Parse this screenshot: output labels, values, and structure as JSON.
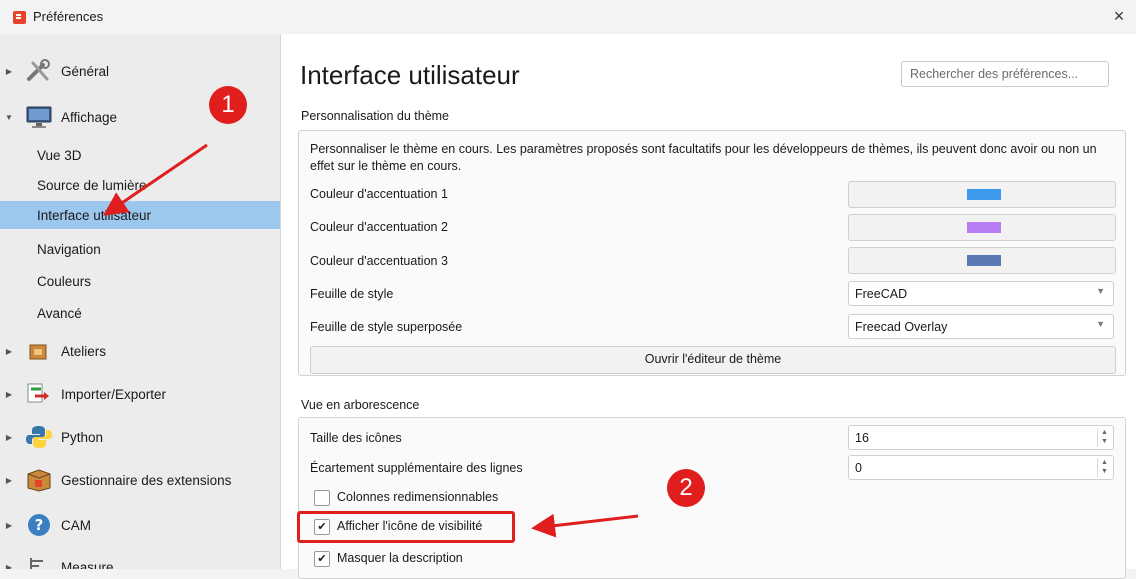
{
  "window": {
    "title": "Préférences",
    "close": "×"
  },
  "sidebar": {
    "items": [
      {
        "label": "Général"
      },
      {
        "label": "Affichage"
      },
      {
        "label": "Ateliers"
      },
      {
        "label": "Importer/Exporter"
      },
      {
        "label": "Python"
      },
      {
        "label": "Gestionnaire des extensions"
      },
      {
        "label": "CAM"
      },
      {
        "label": "Measure"
      }
    ],
    "subitems": [
      {
        "label": "Vue 3D"
      },
      {
        "label": "Source de lumière"
      },
      {
        "label": "Interface utilisateur"
      },
      {
        "label": "Navigation"
      },
      {
        "label": "Couleurs"
      },
      {
        "label": "Avancé"
      }
    ]
  },
  "main": {
    "heading": "Interface utilisateur",
    "search_placeholder": "Rechercher des préférences...",
    "theme_group": {
      "title": "Personnalisation du thème",
      "description": "Personnaliser le thème en cours. Les paramètres proposés sont facultatifs pour les développeurs de thèmes, ils peuvent donc avoir ou non un effet sur le thème en cours.",
      "accent1_label": "Couleur d'accentuation 1",
      "accent2_label": "Couleur d'accentuation 2",
      "accent3_label": "Couleur d'accentuation 3",
      "stylesheet_label": "Feuille de style",
      "stylesheet_value": "FreeCAD",
      "overlay_label": "Feuille de style superposée",
      "overlay_value": "Freecad Overlay",
      "editor_button": "Ouvrir l'éditeur de thème"
    },
    "tree_group": {
      "title": "Vue en arborescence",
      "icon_size_label": "Taille des icônes",
      "icon_size_value": "16",
      "spacing_label": "Écartement supplémentaire des lignes",
      "spacing_value": "0",
      "resizable_label": "Colonnes redimensionnables",
      "visibility_label": "Afficher l'icône de visibilité",
      "hide_desc_label": "Masquer la description"
    }
  },
  "colors": {
    "accent1": "#3d9bef",
    "accent2": "#b67ef2",
    "accent3": "#5a78b4",
    "selected": "#9dc8ee",
    "annotation_red": "#e01e1e"
  },
  "checkboxes": {
    "resizable": false,
    "visibility": true,
    "hide_desc": true
  },
  "annotations": {
    "badge1": "1",
    "badge2": "2"
  }
}
